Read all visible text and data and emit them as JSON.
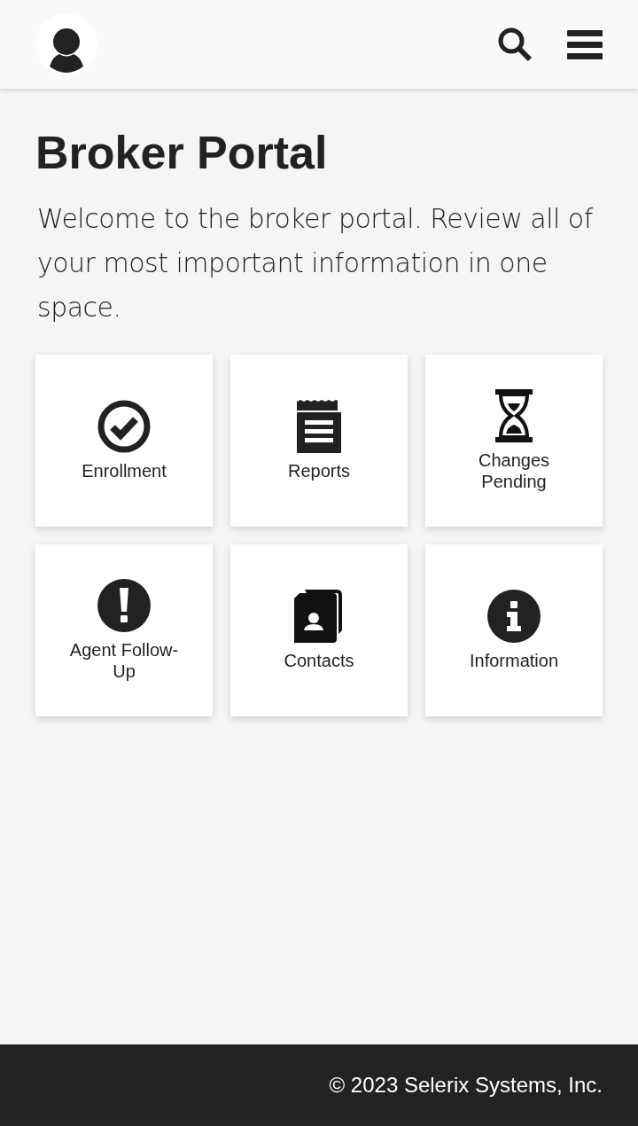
{
  "title": "Broker Portal",
  "intro": "Welcome to the broker portal. Review all of your most important information in one space.",
  "tiles": [
    {
      "label": "Enrollment",
      "kind": "check"
    },
    {
      "label": "Reports",
      "kind": "report"
    },
    {
      "label": "Changes Pending",
      "kind": "hourglass"
    },
    {
      "label": "Agent Follow-Up",
      "kind": "alert"
    },
    {
      "label": "Contacts",
      "kind": "contacts"
    },
    {
      "label": "Information",
      "kind": "info"
    }
  ],
  "footer": "© 2023 Selerix Systems, Inc."
}
